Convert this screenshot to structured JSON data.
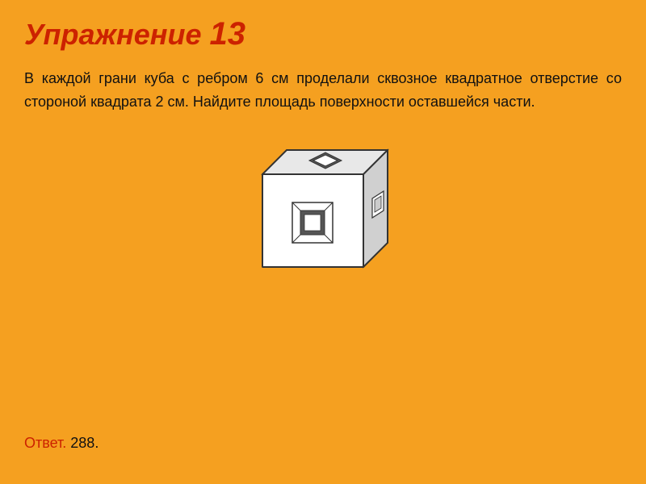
{
  "title": {
    "prefix": "Упражнение",
    "number": "13"
  },
  "problem": {
    "text": "В каждой грани куба с ребром 6 см проделали сквозное квадратное отверстие со стороной квадрата 2 см. Найдите площадь поверхности оставшейся части."
  },
  "answer": {
    "label": "Ответ.",
    "value": " 288."
  },
  "background_color": "#F5A020",
  "title_color": "#CC2200"
}
